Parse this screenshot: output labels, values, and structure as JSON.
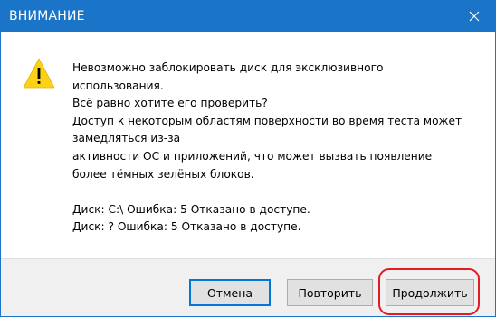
{
  "window": {
    "title": "ВНИМАНИЕ",
    "close_icon": "close-icon",
    "accent_color": "#1a74c8"
  },
  "message": {
    "icon": "warning-icon",
    "icon_color": "#fcd116",
    "lines": [
      "Невозможно заблокировать диск для эксклюзивного",
      "использования.",
      "Всё равно хотите его проверить?",
      "Доступ к некоторым областям поверхности во время теста может",
      "замедляться из-за",
      "активности ОС и приложений, что может вызвать появление",
      "более тёмных зелёных блоков."
    ],
    "details": [
      "Диск: C:\\ Ошибка: 5 Отказано в доступе.",
      "Диск: ? Ошибка: 5 Отказано в доступе."
    ]
  },
  "buttons": {
    "cancel": "Отмена",
    "retry": "Повторить",
    "continue": "Продолжить"
  },
  "highlight_color": "#e31b23"
}
